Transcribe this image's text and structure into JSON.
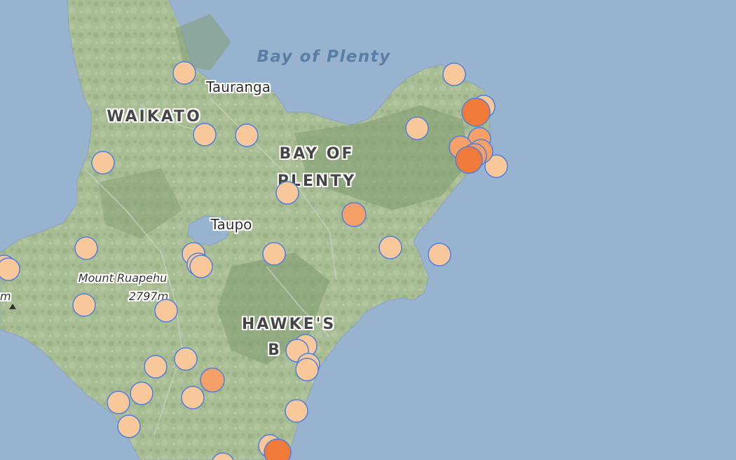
{
  "map": {
    "water_label": "Bay of Plenty",
    "regions": [
      "WAIKATO",
      "BAY OF",
      "PLENTY",
      "HAWKE'S",
      "B"
    ],
    "towns": [
      "Tauranga",
      "Taupo"
    ],
    "peak": {
      "name": "Mount Ruapehu",
      "elevation": "2797m",
      "edge_text": "m"
    }
  },
  "legend_colors": {
    "water": "#97b3d0",
    "land": "#a7bb92",
    "small_quake": "#f8c89b",
    "medium_quake": "#f5a067",
    "large_quake": "#f07a3a",
    "quake_outline": "#4f7fe0"
  }
}
